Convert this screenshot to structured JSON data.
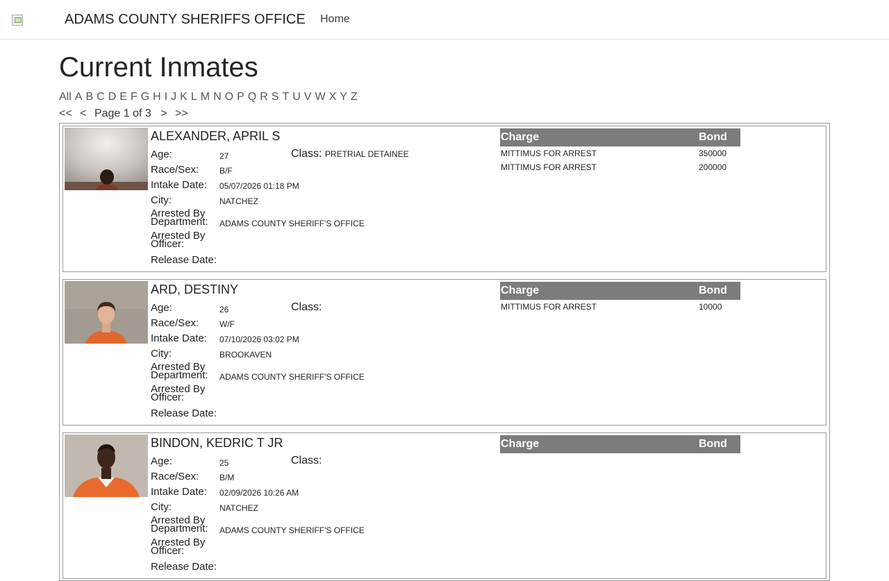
{
  "header": {
    "brand": "ADAMS COUNTY SHERIFFS OFFICE",
    "nav_home": "Home"
  },
  "page": {
    "title": "Current Inmates",
    "alphabet": [
      "All",
      "A",
      "B",
      "C",
      "D",
      "E",
      "F",
      "G",
      "H",
      "I",
      "J",
      "K",
      "L",
      "M",
      "N",
      "O",
      "P",
      "Q",
      "R",
      "S",
      "T",
      "U",
      "V",
      "W",
      "X",
      "Y",
      "Z"
    ],
    "pager": {
      "first": "<<",
      "prev": "<",
      "label": "Page 1 of 3",
      "next": ">",
      "last": ">>"
    }
  },
  "labels": {
    "age": "Age:",
    "race_sex": "Race/Sex:",
    "intake": "Intake Date:",
    "city": "City:",
    "arrested_dept_1": "Arrested By",
    "arrested_dept_2": "Department:",
    "arrested_officer_1": "Arrested By",
    "arrested_officer_2": "Officer:",
    "release": "Release Date:",
    "class": "Class:",
    "charge_col": "Charge",
    "bond_col": "Bond"
  },
  "inmates": [
    {
      "name": "ALEXANDER, APRIL S",
      "age": "27",
      "class": "PRETRIAL DETAINEE",
      "race_sex": "B/F",
      "intake": "05/07/2026 01:18 PM",
      "city": "NATCHEZ",
      "department": "ADAMS COUNTY SHERIFF'S OFFICE",
      "officer": "",
      "release": "",
      "charges": [
        {
          "charge": "MITTIMUS FOR ARREST",
          "bond": "350000"
        },
        {
          "charge": "MITTIMUS FOR ARREST",
          "bond": "200000"
        }
      ]
    },
    {
      "name": "ARD, DESTINY",
      "age": "26",
      "class": "",
      "race_sex": "W/F",
      "intake": "07/10/2026 03:02 PM",
      "city": "BROOKAVEN",
      "department": "ADAMS COUNTY SHERIFF'S OFFICE",
      "officer": "",
      "release": "",
      "charges": [
        {
          "charge": "MITTIMUS FOR ARREST",
          "bond": "10000"
        }
      ]
    },
    {
      "name": "BINDON, KEDRIC T JR",
      "age": "25",
      "class": "",
      "race_sex": "B/M",
      "intake": "02/09/2026 10:26 AM",
      "city": "NATCHEZ",
      "department": "ADAMS COUNTY SHERIFF'S OFFICE",
      "officer": "",
      "release": "",
      "charges": []
    }
  ]
}
